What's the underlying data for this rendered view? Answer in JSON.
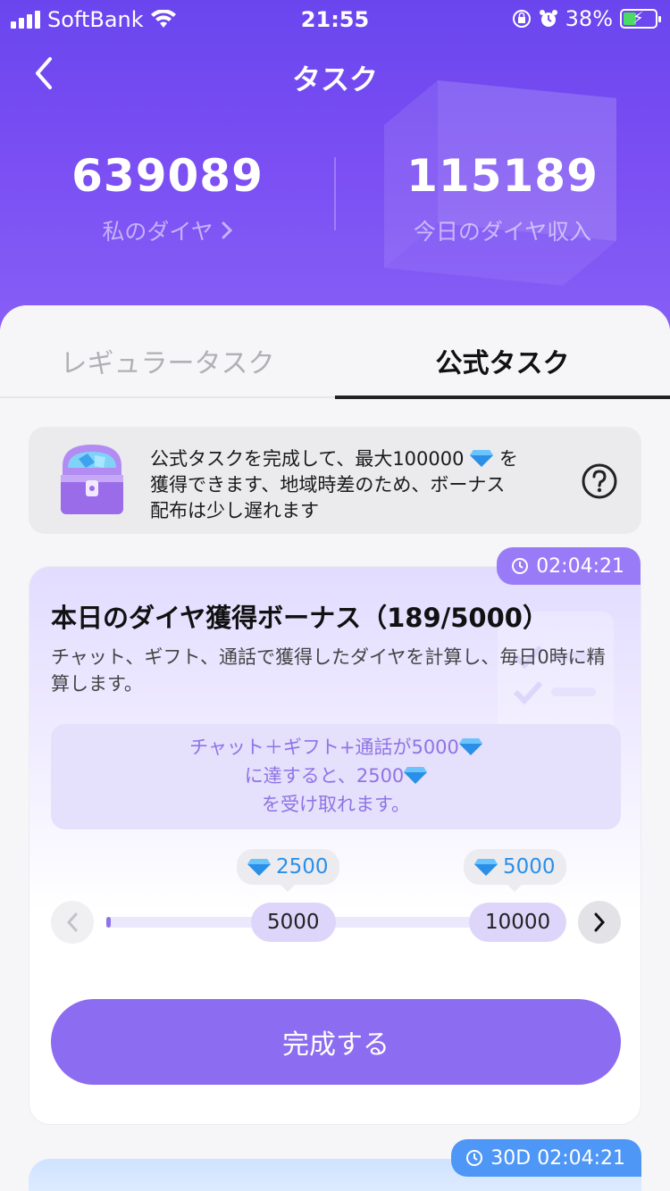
{
  "status_bar": {
    "carrier": "SoftBank",
    "time": "21:55",
    "battery": "38%"
  },
  "header": {
    "title": "タスク"
  },
  "stats": {
    "my_diamonds_value": "639089",
    "my_diamonds_label": "私のダイヤ",
    "today_income_value": "115189",
    "today_income_label": "今日のダイヤ収入"
  },
  "tabs": {
    "regular": "レギュラータスク",
    "official": "公式タスク",
    "active": "official"
  },
  "banner": {
    "line1a": "公式タスクを完成して、最大100000",
    "line1b": "を",
    "line2": "獲得できます、地域時差のため、ボーナス",
    "line3": "配布は少し遅れます"
  },
  "task": {
    "timer": "02:04:21",
    "title": "本日のダイヤ獲得ボーナス（189/5000）",
    "description": "チャット、ギフト、通話で獲得したダイヤを計算し、毎日0時に精算します。",
    "goal_line1": "チャット＋ギフト+通話が5000",
    "goal_line2": "に達すると、2500",
    "goal_line3": "を受け取れます。",
    "progress": 189,
    "progress_max": 5000,
    "rewards": [
      {
        "reward": "2500",
        "threshold": "5000"
      },
      {
        "reward": "5000",
        "threshold": "10000"
      }
    ],
    "button": "完成する"
  },
  "next_task": {
    "timer": "30D 02:04:21"
  },
  "colors": {
    "header": "#7b4ff3",
    "accent": "#8c6cf0",
    "diamond": "#2b8fe8"
  }
}
